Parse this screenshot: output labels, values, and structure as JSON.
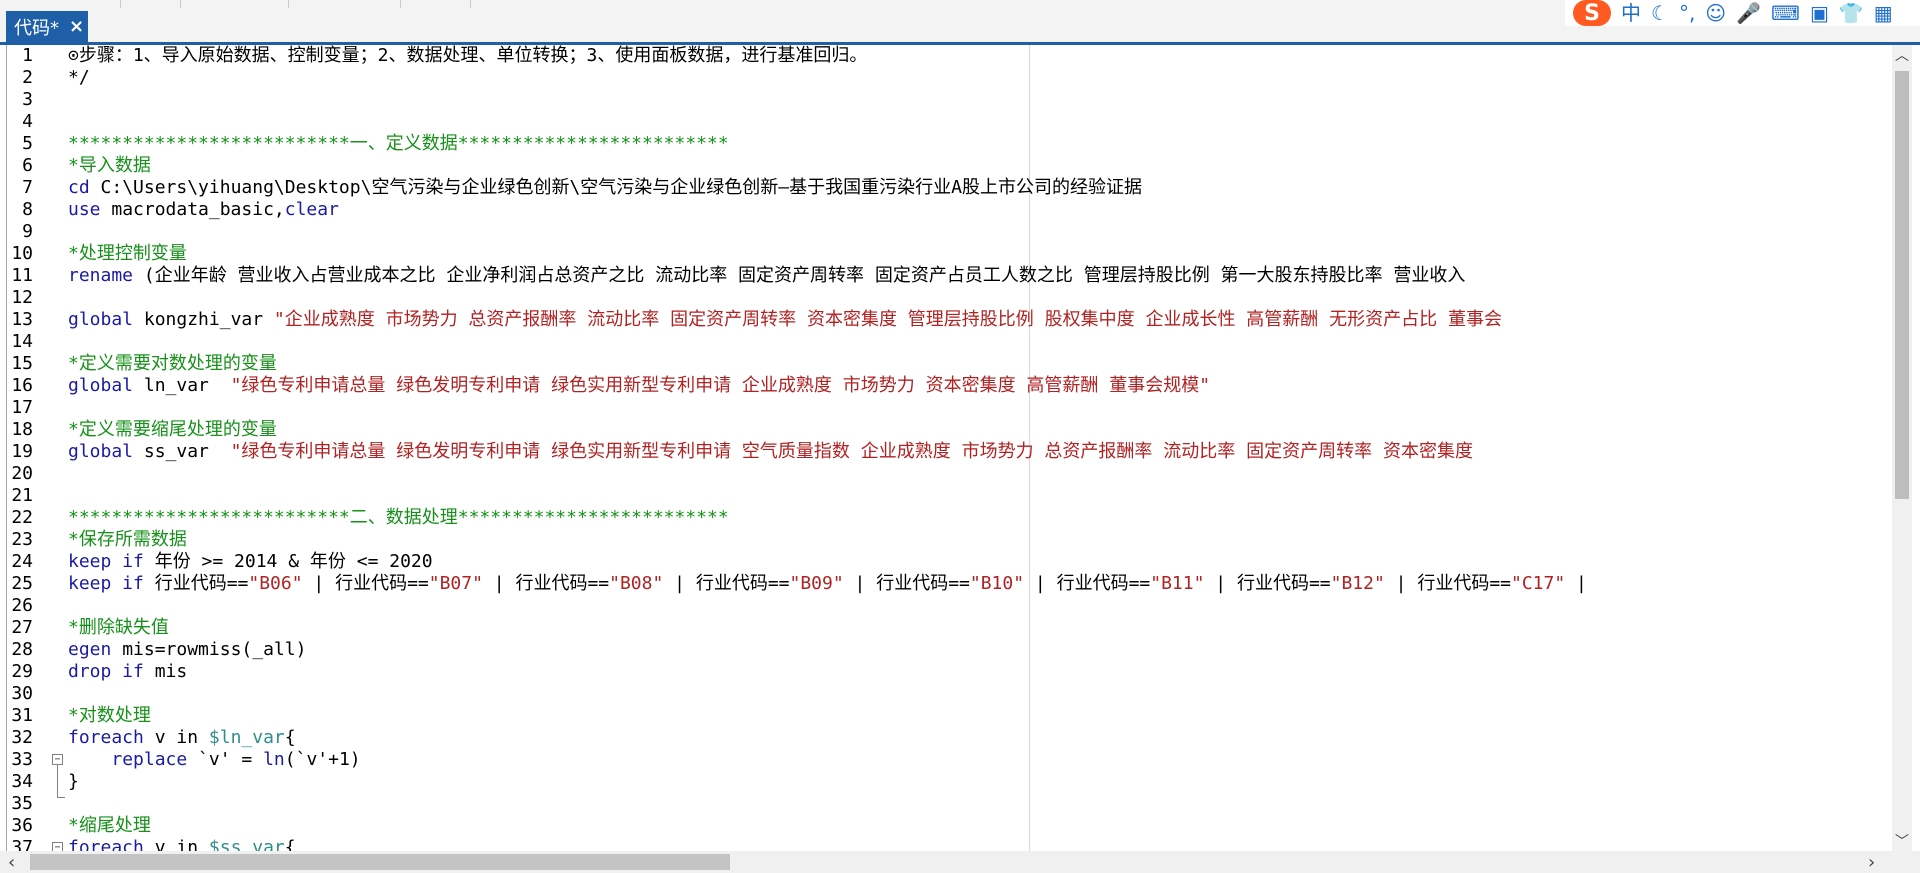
{
  "tab": {
    "title": "代码*",
    "close_glyph": "×"
  },
  "ime": {
    "logo": "S",
    "items": [
      "中",
      "☾",
      "°,",
      "☺",
      "🎤",
      "⌨",
      "▣",
      "👕",
      "▦"
    ]
  },
  "lines": [
    {
      "n": "1",
      "segs": [
        {
          "t": "⊙步骤：1、导入原始数据、控制变量；2、数据处理、单位转换；3、使用面板数据，进行基准回归。",
          "c": ""
        }
      ]
    },
    {
      "n": "2",
      "segs": [
        {
          "t": "*/",
          "c": ""
        }
      ]
    },
    {
      "n": "3",
      "segs": []
    },
    {
      "n": "4",
      "segs": []
    },
    {
      "n": "5",
      "segs": [
        {
          "t": "**************************一、定义数据*************************",
          "c": "comment"
        }
      ]
    },
    {
      "n": "6",
      "segs": [
        {
          "t": "*导入数据",
          "c": "comment"
        }
      ]
    },
    {
      "n": "7",
      "segs": [
        {
          "t": "cd",
          "c": "kw"
        },
        {
          "t": " C:\\Users\\yihuang\\Desktop\\空气污染与企业绿色创新\\空气污染与企业绿色创新—基于我国重污染行业A股上市公司的经验证据",
          "c": ""
        }
      ]
    },
    {
      "n": "8",
      "segs": [
        {
          "t": "use",
          "c": "kw"
        },
        {
          "t": " macrodata_basic,",
          "c": ""
        },
        {
          "t": "clear",
          "c": "kw"
        }
      ]
    },
    {
      "n": "9",
      "segs": []
    },
    {
      "n": "10",
      "segs": [
        {
          "t": "*处理控制变量",
          "c": "comment"
        }
      ]
    },
    {
      "n": "11",
      "segs": [
        {
          "t": "rename",
          "c": "kw"
        },
        {
          "t": " (企业年龄 营业收入占营业成本之比 企业净利润占总资产之比 流动比率 固定资产周转率 固定资产占员工人数之比 管理层持股比例 第一大股东持股比率 营业收入",
          "c": ""
        }
      ]
    },
    {
      "n": "12",
      "segs": []
    },
    {
      "n": "13",
      "segs": [
        {
          "t": "global",
          "c": "kw"
        },
        {
          "t": " kongzhi_var ",
          "c": ""
        },
        {
          "t": "\"企业成熟度 市场势力 总资产报酬率 流动比率 固定资产周转率 资本密集度 管理层持股比例 股权集中度 企业成长性 高管薪酬 无形资产占比 董事会",
          "c": "str"
        }
      ]
    },
    {
      "n": "14",
      "segs": []
    },
    {
      "n": "15",
      "segs": [
        {
          "t": "*定义需要对数处理的变量",
          "c": "comment"
        }
      ]
    },
    {
      "n": "16",
      "segs": [
        {
          "t": "global",
          "c": "kw"
        },
        {
          "t": " ln_var  ",
          "c": ""
        },
        {
          "t": "\"绿色专利申请总量 绿色发明专利申请 绿色实用新型专利申请 企业成熟度 市场势力 资本密集度 高管薪酬 董事会规模\"",
          "c": "str"
        }
      ]
    },
    {
      "n": "17",
      "segs": []
    },
    {
      "n": "18",
      "segs": [
        {
          "t": "*定义需要缩尾处理的变量",
          "c": "comment"
        }
      ]
    },
    {
      "n": "19",
      "segs": [
        {
          "t": "global",
          "c": "kw"
        },
        {
          "t": " ss_var  ",
          "c": ""
        },
        {
          "t": "\"绿色专利申请总量 绿色发明专利申请 绿色实用新型专利申请 空气质量指数 企业成熟度 市场势力 总资产报酬率 流动比率 固定资产周转率 资本密集度",
          "c": "str"
        }
      ]
    },
    {
      "n": "20",
      "segs": []
    },
    {
      "n": "21",
      "segs": []
    },
    {
      "n": "22",
      "segs": [
        {
          "t": "**************************二、数据处理*************************",
          "c": "comment"
        }
      ]
    },
    {
      "n": "23",
      "segs": [
        {
          "t": "*保存所需数据",
          "c": "comment"
        }
      ]
    },
    {
      "n": "24",
      "segs": [
        {
          "t": "keep if",
          "c": "kw"
        },
        {
          "t": " 年份 >= 2014 & 年份 <= 2020",
          "c": ""
        }
      ]
    },
    {
      "n": "25",
      "segs": [
        {
          "t": "keep if",
          "c": "kw"
        },
        {
          "t": " 行业代码==",
          "c": ""
        },
        {
          "t": "\"B06\"",
          "c": "str"
        },
        {
          "t": " | 行业代码==",
          "c": ""
        },
        {
          "t": "\"B07\"",
          "c": "str"
        },
        {
          "t": " | 行业代码==",
          "c": ""
        },
        {
          "t": "\"B08\"",
          "c": "str"
        },
        {
          "t": " | 行业代码==",
          "c": ""
        },
        {
          "t": "\"B09\"",
          "c": "str"
        },
        {
          "t": " | 行业代码==",
          "c": ""
        },
        {
          "t": "\"B10\"",
          "c": "str"
        },
        {
          "t": " | 行业代码==",
          "c": ""
        },
        {
          "t": "\"B11\"",
          "c": "str"
        },
        {
          "t": " | 行业代码==",
          "c": ""
        },
        {
          "t": "\"B12\"",
          "c": "str"
        },
        {
          "t": " | 行业代码==",
          "c": ""
        },
        {
          "t": "\"C17\"",
          "c": "str"
        },
        {
          "t": " |",
          "c": ""
        }
      ]
    },
    {
      "n": "26",
      "segs": []
    },
    {
      "n": "27",
      "segs": [
        {
          "t": "*删除缺失值",
          "c": "comment"
        }
      ]
    },
    {
      "n": "28",
      "segs": [
        {
          "t": "egen",
          "c": "kw"
        },
        {
          "t": " mis=rowmiss(_all)",
          "c": ""
        }
      ]
    },
    {
      "n": "29",
      "segs": [
        {
          "t": "drop if",
          "c": "kw"
        },
        {
          "t": " mis",
          "c": ""
        }
      ]
    },
    {
      "n": "30",
      "segs": []
    },
    {
      "n": "31",
      "segs": [
        {
          "t": "*对数处理",
          "c": "comment"
        }
      ]
    },
    {
      "n": "32",
      "segs": [
        {
          "t": "foreach",
          "c": "kw"
        },
        {
          "t": " v in ",
          "c": ""
        },
        {
          "t": "$ln_var",
          "c": "mac"
        },
        {
          "t": "{",
          "c": ""
        }
      ]
    },
    {
      "n": "33",
      "segs": [
        {
          "t": "    ",
          "c": ""
        },
        {
          "t": "replace",
          "c": "kw"
        },
        {
          "t": " `v' = ",
          "c": ""
        },
        {
          "t": "ln",
          "c": "fn"
        },
        {
          "t": "(`v'+1)",
          "c": ""
        }
      ]
    },
    {
      "n": "34",
      "segs": [
        {
          "t": "}",
          "c": ""
        }
      ]
    },
    {
      "n": "35",
      "segs": []
    },
    {
      "n": "36",
      "segs": [
        {
          "t": "*缩尾处理",
          "c": "comment"
        }
      ]
    },
    {
      "n": "37",
      "segs": [
        {
          "t": "foreach",
          "c": "kw"
        },
        {
          "t": " v in ",
          "c": ""
        },
        {
          "t": "$ss_var",
          "c": "mac"
        },
        {
          "t": "{",
          "c": ""
        }
      ]
    }
  ],
  "scroll": {
    "up": "︿",
    "down": "﹀",
    "left": "‹",
    "right": "›"
  }
}
